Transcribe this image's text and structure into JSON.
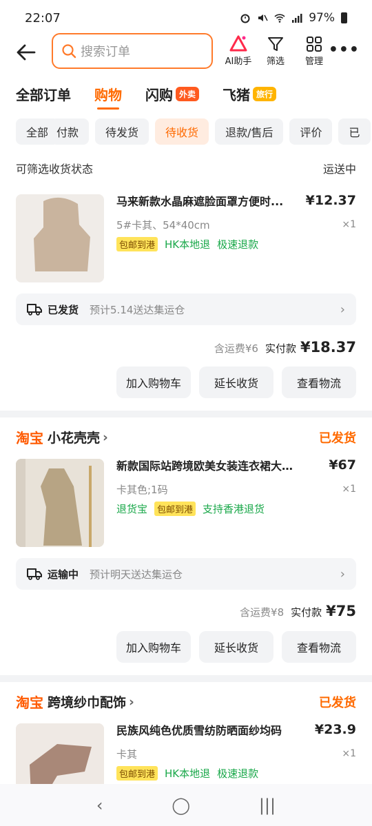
{
  "status": {
    "time": "22:07",
    "battery": "97%"
  },
  "header": {
    "search_placeholder": "搜索订单",
    "ai_label": "AI助手",
    "filter_label": "筛选",
    "manage_label": "管理",
    "more": "•••"
  },
  "tabs": [
    {
      "label": "全部订单"
    },
    {
      "label": "购物"
    },
    {
      "label": "闪购",
      "badge": "外卖"
    },
    {
      "label": "飞猪",
      "badge": "旅行"
    }
  ],
  "chips": [
    "全部",
    "付款",
    "待发货",
    "待收货",
    "退款/售后",
    "评价",
    "已"
  ],
  "filterbar": {
    "left": "可筛选收货状态",
    "right": "运送中"
  },
  "orders": [
    {
      "title": "马来新款水晶麻遮脸面罩方便时...",
      "price": "¥12.37",
      "spec": "5#卡其、54*40cm",
      "qty": "×1",
      "tag_yellow": "包邮到港",
      "tag_green1": "HK本地退",
      "tag_green2": "极速退款",
      "logi_status": "已发货",
      "logi_eta": "预计5.14送达集运仓",
      "shipping": "含运费¥6",
      "paid_label": "实付款",
      "paid_amount": "¥18.37",
      "btn1": "加入购物车",
      "btn2": "延长收货",
      "btn3": "查看物流"
    },
    {
      "shop_brand": "淘宝",
      "shop_name": "小花壳壳",
      "shop_status": "已发货",
      "title": "新款国际站跨境欧美女装连衣裙大码...",
      "price": "¥67",
      "spec": "卡其色;1码",
      "qty": "×1",
      "tag_green0": "退货宝",
      "tag_yellow": "包邮到港",
      "tag_green1": "支持香港退货",
      "logi_status": "运输中",
      "logi_eta": "预计明天送达集运仓",
      "shipping": "含运费¥8",
      "paid_label": "实付款",
      "paid_amount": "¥75",
      "btn1": "加入购物车",
      "btn2": "延长收货",
      "btn3": "查看物流"
    },
    {
      "shop_brand": "淘宝",
      "shop_name": "跨境纱巾配饰",
      "shop_status": "已发货",
      "title": "民族风纯色优质雪纺防晒面纱均码",
      "price": "¥23.9",
      "spec": "卡其",
      "qty": "×1",
      "tag_yellow": "包邮到港",
      "tag_green1": "HK本地退",
      "tag_green2": "极速退款"
    }
  ],
  "colors": {
    "accent": "#ff6a00",
    "green": "#1aa84a",
    "yellow_tag": "#ffe35a"
  }
}
